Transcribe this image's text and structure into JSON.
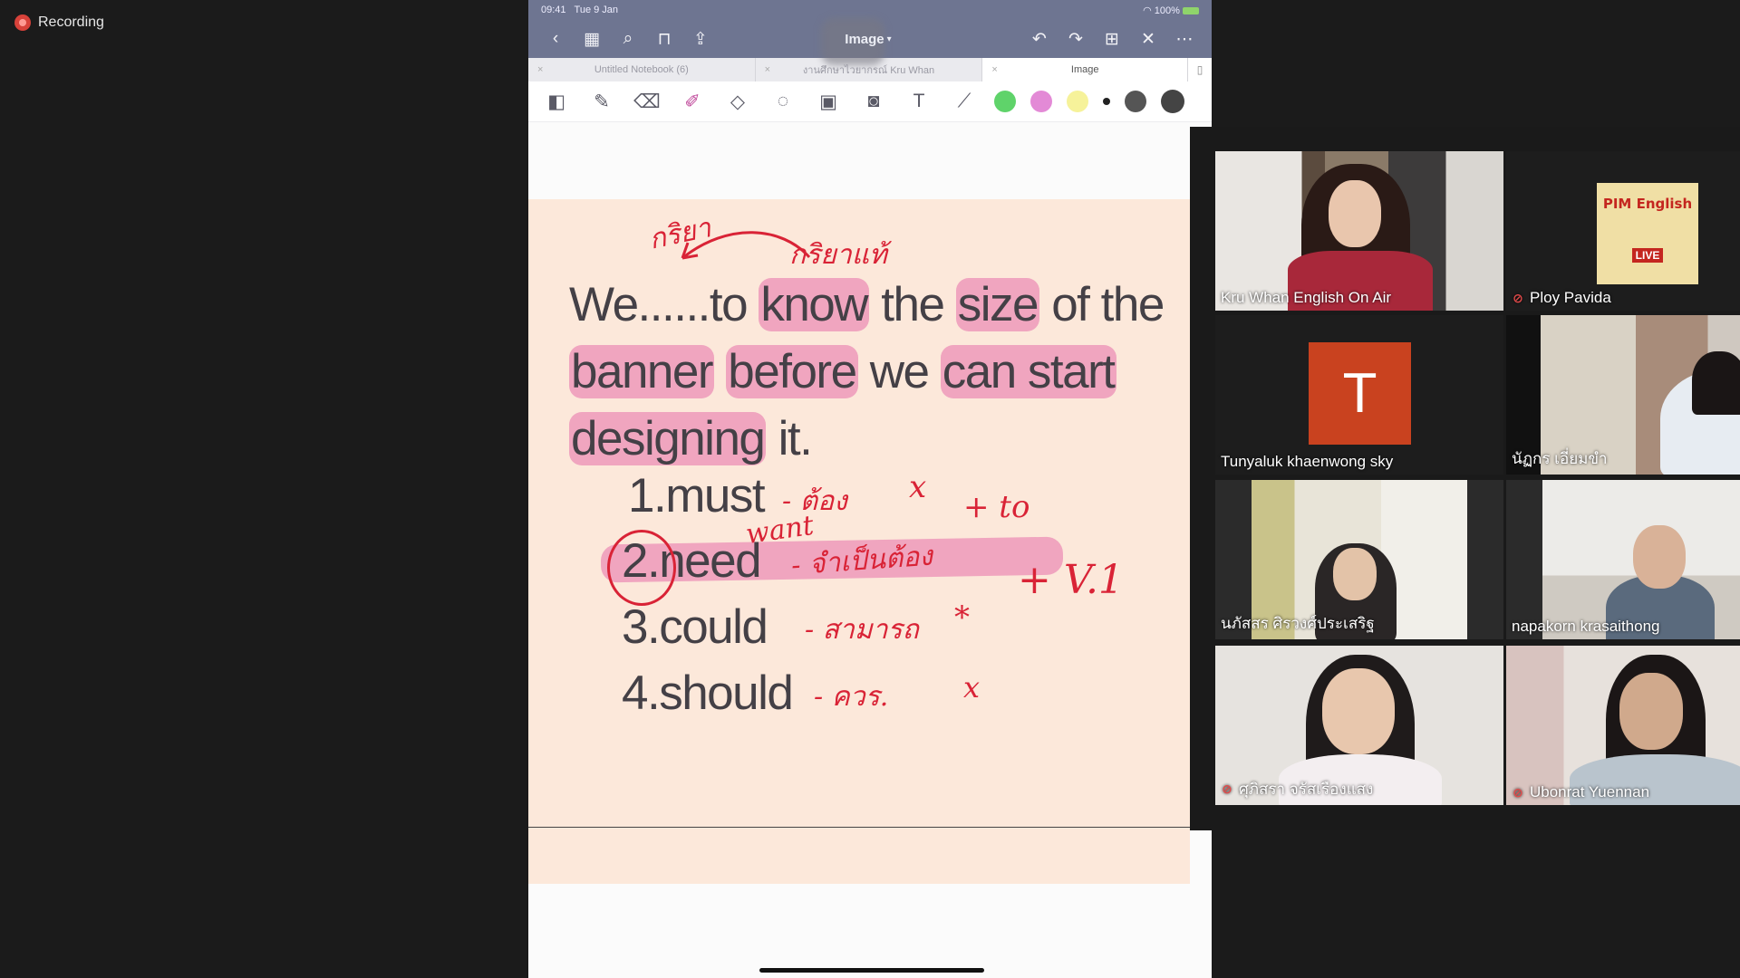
{
  "recording": {
    "label": "Recording"
  },
  "ipad": {
    "status": {
      "time": "09:41",
      "date": "Tue 9 Jan",
      "battery": "100%"
    },
    "doc_title": "Image",
    "tabs": [
      {
        "label": "Untitled Notebook (6)"
      },
      {
        "label": "งานศึกษาไวยากรณ์ Kru Whan"
      },
      {
        "label": "Image"
      }
    ],
    "colors": {
      "bar": "#6e7591",
      "highlight": "#e66eaa",
      "ink": "#d92336",
      "swatches": [
        "#5fd36a",
        "#e38ad6",
        "#f6f29a",
        "#222222",
        "#555555",
        "#444444"
      ]
    }
  },
  "slide": {
    "sentence_parts": [
      "We......to ",
      "know",
      " the ",
      "size",
      " of the ",
      "banner",
      " ",
      "before",
      " we ",
      "can start",
      " ",
      "designing",
      " it."
    ],
    "options": [
      "1.must",
      "2.need",
      "3.could",
      "4.should"
    ],
    "annotations": {
      "top_left": "กริยา",
      "top_mid": "กริยาแท้",
      "must": "- ต้อง",
      "want": "want",
      "need": "- จำเป็นต้อง",
      "plus_to": "+ to",
      "could": "- สามารถ",
      "plus_v1": "+ V.1",
      "should": "- ควร.",
      "x1": "x",
      "x2": "*",
      "x3": "x"
    }
  },
  "participants": [
    {
      "name": "Kru Whan English On Air",
      "muted": false,
      "active": true
    },
    {
      "name": "Ploy Pavida",
      "muted": true,
      "active": false,
      "thumb_title": "PIM English",
      "thumb_sub": "LIVE"
    },
    {
      "name": "Tunyaluk khaenwong sky",
      "muted": false,
      "active": false,
      "initial": "T"
    },
    {
      "name": "นัฏกร เอี่ยมขำ",
      "muted": false,
      "active": false
    },
    {
      "name": "นภัสสร ศิรวงศ์ประเสริฐ",
      "muted": false,
      "active": false
    },
    {
      "name": "napakorn krasaithong",
      "muted": false,
      "active": false
    },
    {
      "name": "ศุภิสรา จรัสเรืองแสง",
      "muted": true,
      "active": false
    },
    {
      "name": "Ubonrat Yuennan",
      "muted": true,
      "active": false
    }
  ]
}
